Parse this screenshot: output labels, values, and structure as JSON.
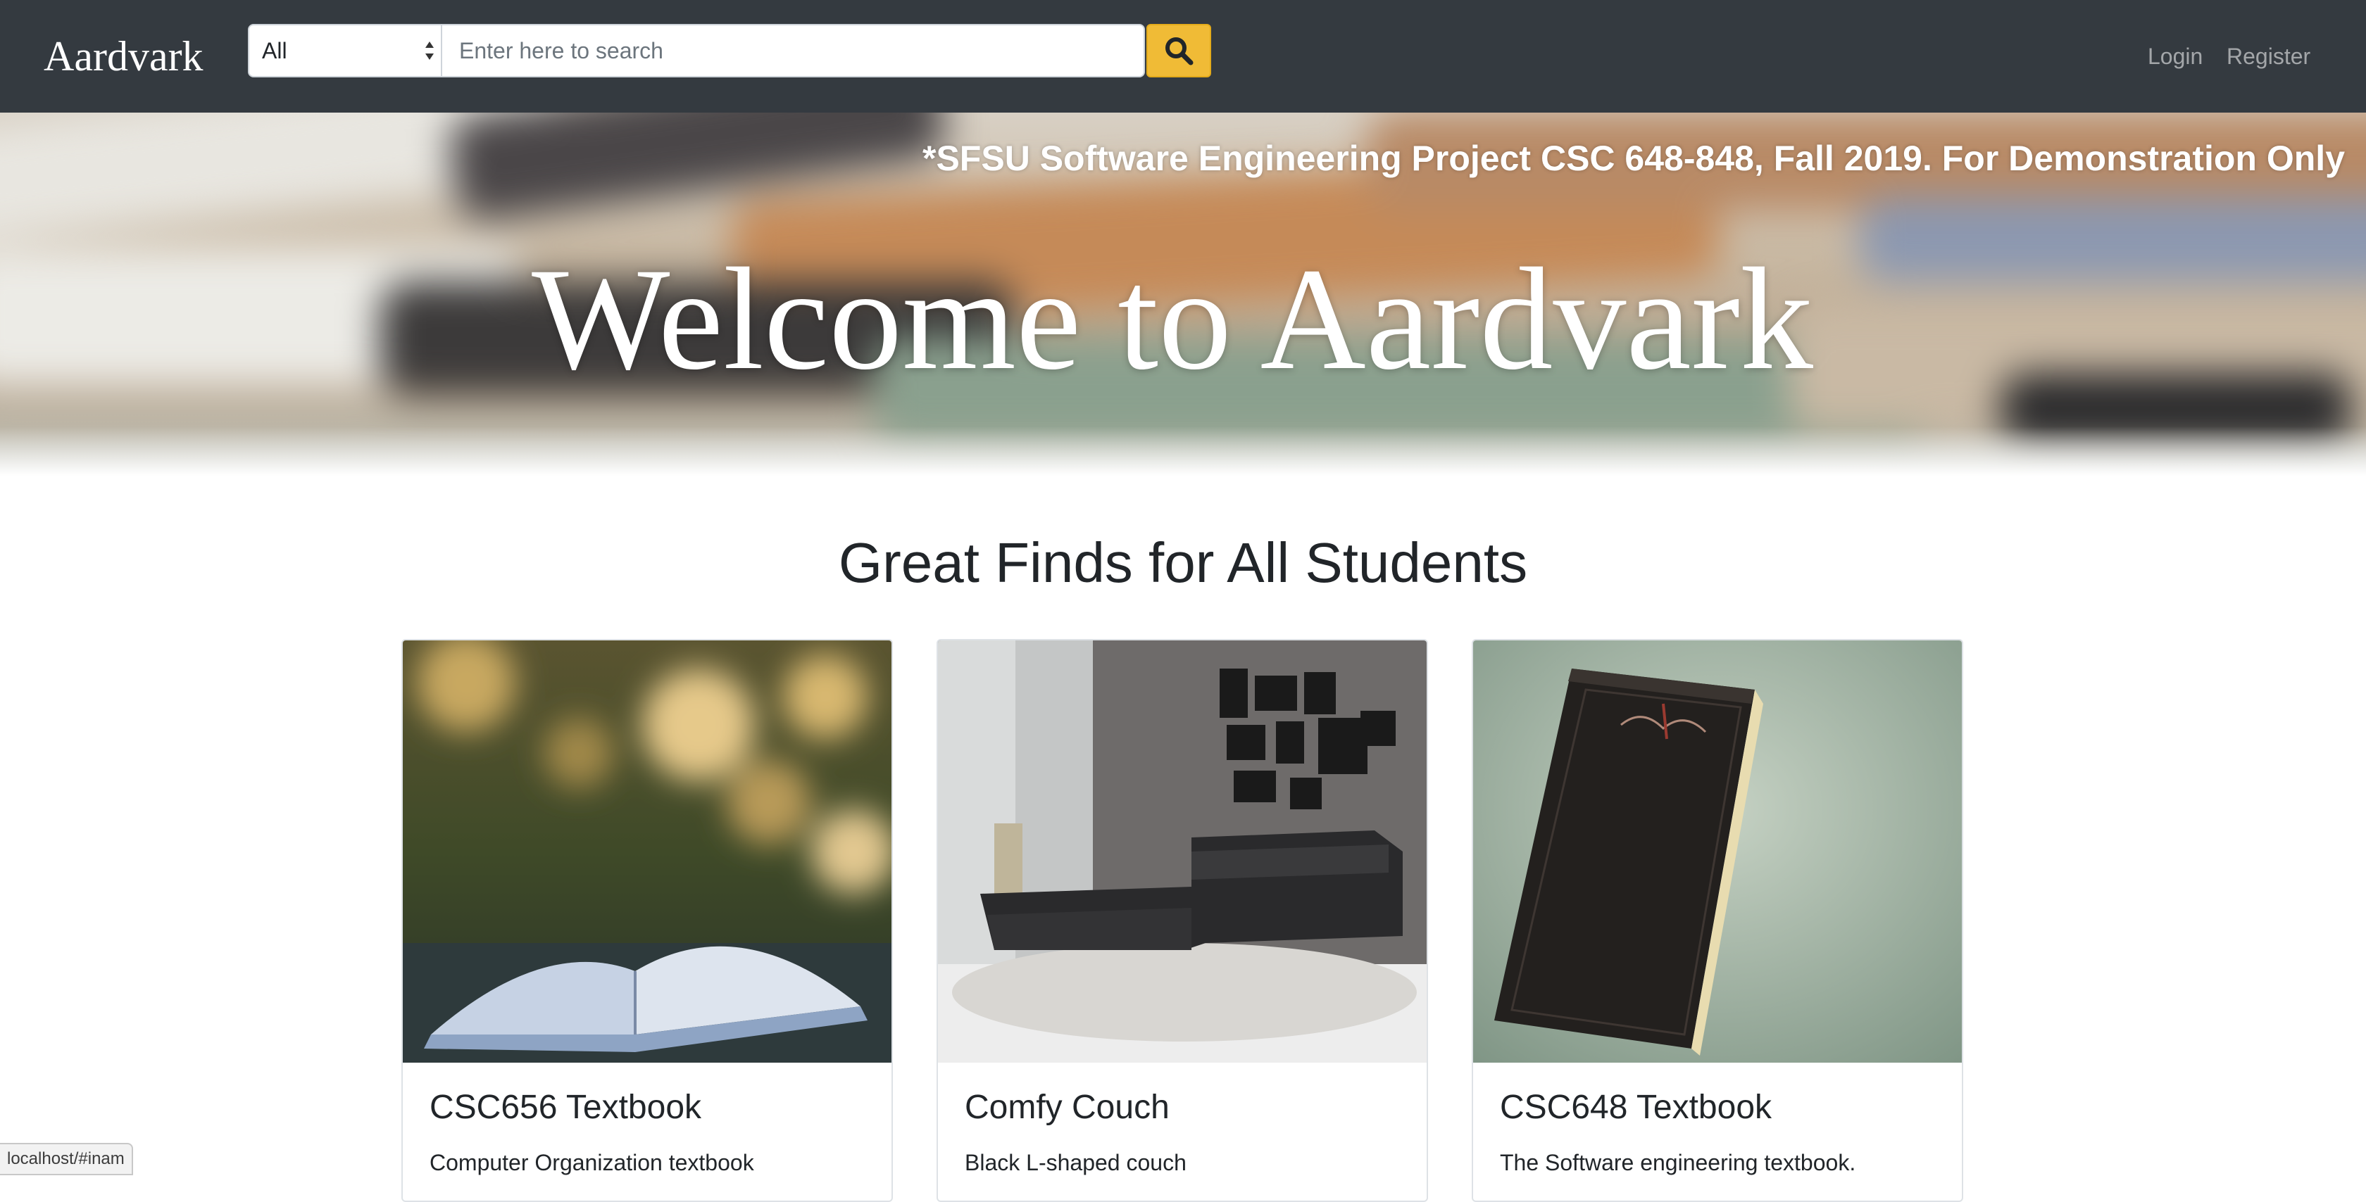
{
  "navbar": {
    "brand": "Aardvark",
    "category_select": {
      "selected": "All"
    },
    "search": {
      "placeholder": "Enter here to search",
      "value": ""
    },
    "search_button_icon": "search-icon",
    "links": {
      "login": "Login",
      "register": "Register"
    },
    "colors": {
      "background": "#343a40",
      "search_button": "#f0bb36"
    }
  },
  "hero": {
    "disclaimer": "*SFSU Software Engineering Project CSC 648-848, Fall 2019. For Demonstration Only",
    "welcome": "Welcome to Aardvark"
  },
  "main": {
    "section_title": "Great Finds for All Students",
    "cards": [
      {
        "title": "CSC656 Textbook",
        "text": "Computer Organization textbook",
        "image": "open-book-photo"
      },
      {
        "title": "Comfy Couch",
        "text": "Black L-shaped couch",
        "image": "couch-photo"
      },
      {
        "title": "CSC648 Textbook",
        "text": "The Software engineering textbook.",
        "image": "black-book-photo"
      }
    ]
  },
  "status_bar": {
    "url": "localhost/#inam"
  }
}
